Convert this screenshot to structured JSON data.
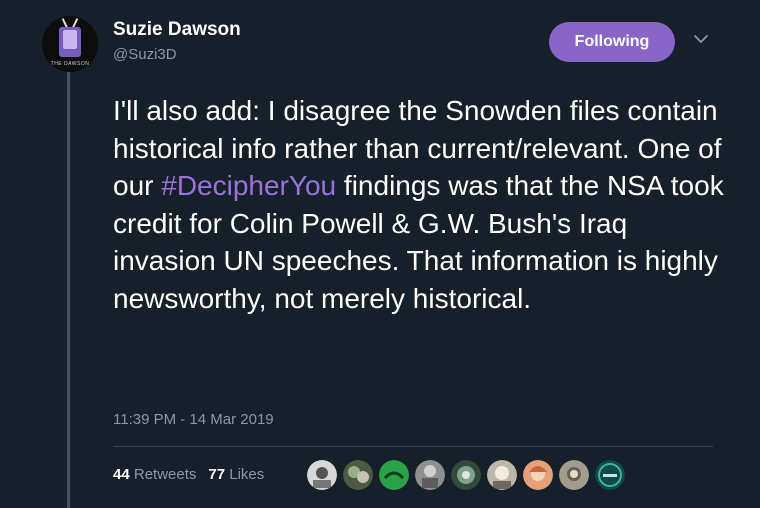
{
  "author": {
    "display_name": "Suzie Dawson",
    "handle": "@Suzi3D",
    "avatar_caption": "THE DAWSON"
  },
  "follow_button": {
    "label": "Following"
  },
  "tweet": {
    "text_before": "I'll also add: I disagree the Snowden files contain historical info rather than current/relevant. One of our ",
    "hashtag": "#DecipherYou",
    "text_after": " findings was that the NSA took credit for Colin Powell & G.W. Bush's Iraq invasion UN speeches. That information is highly newsworthy, not merely historical.",
    "timestamp": "11:39 PM - 14 Mar 2019"
  },
  "engagement": {
    "retweets_count": "44",
    "retweets_label": "Retweets",
    "likes_count": "77",
    "likes_label": "Likes"
  },
  "colors": {
    "background": "#15202b",
    "accent": "#8a65c8",
    "hashtag": "#9a72d9",
    "secondary_text": "#8899a6"
  }
}
